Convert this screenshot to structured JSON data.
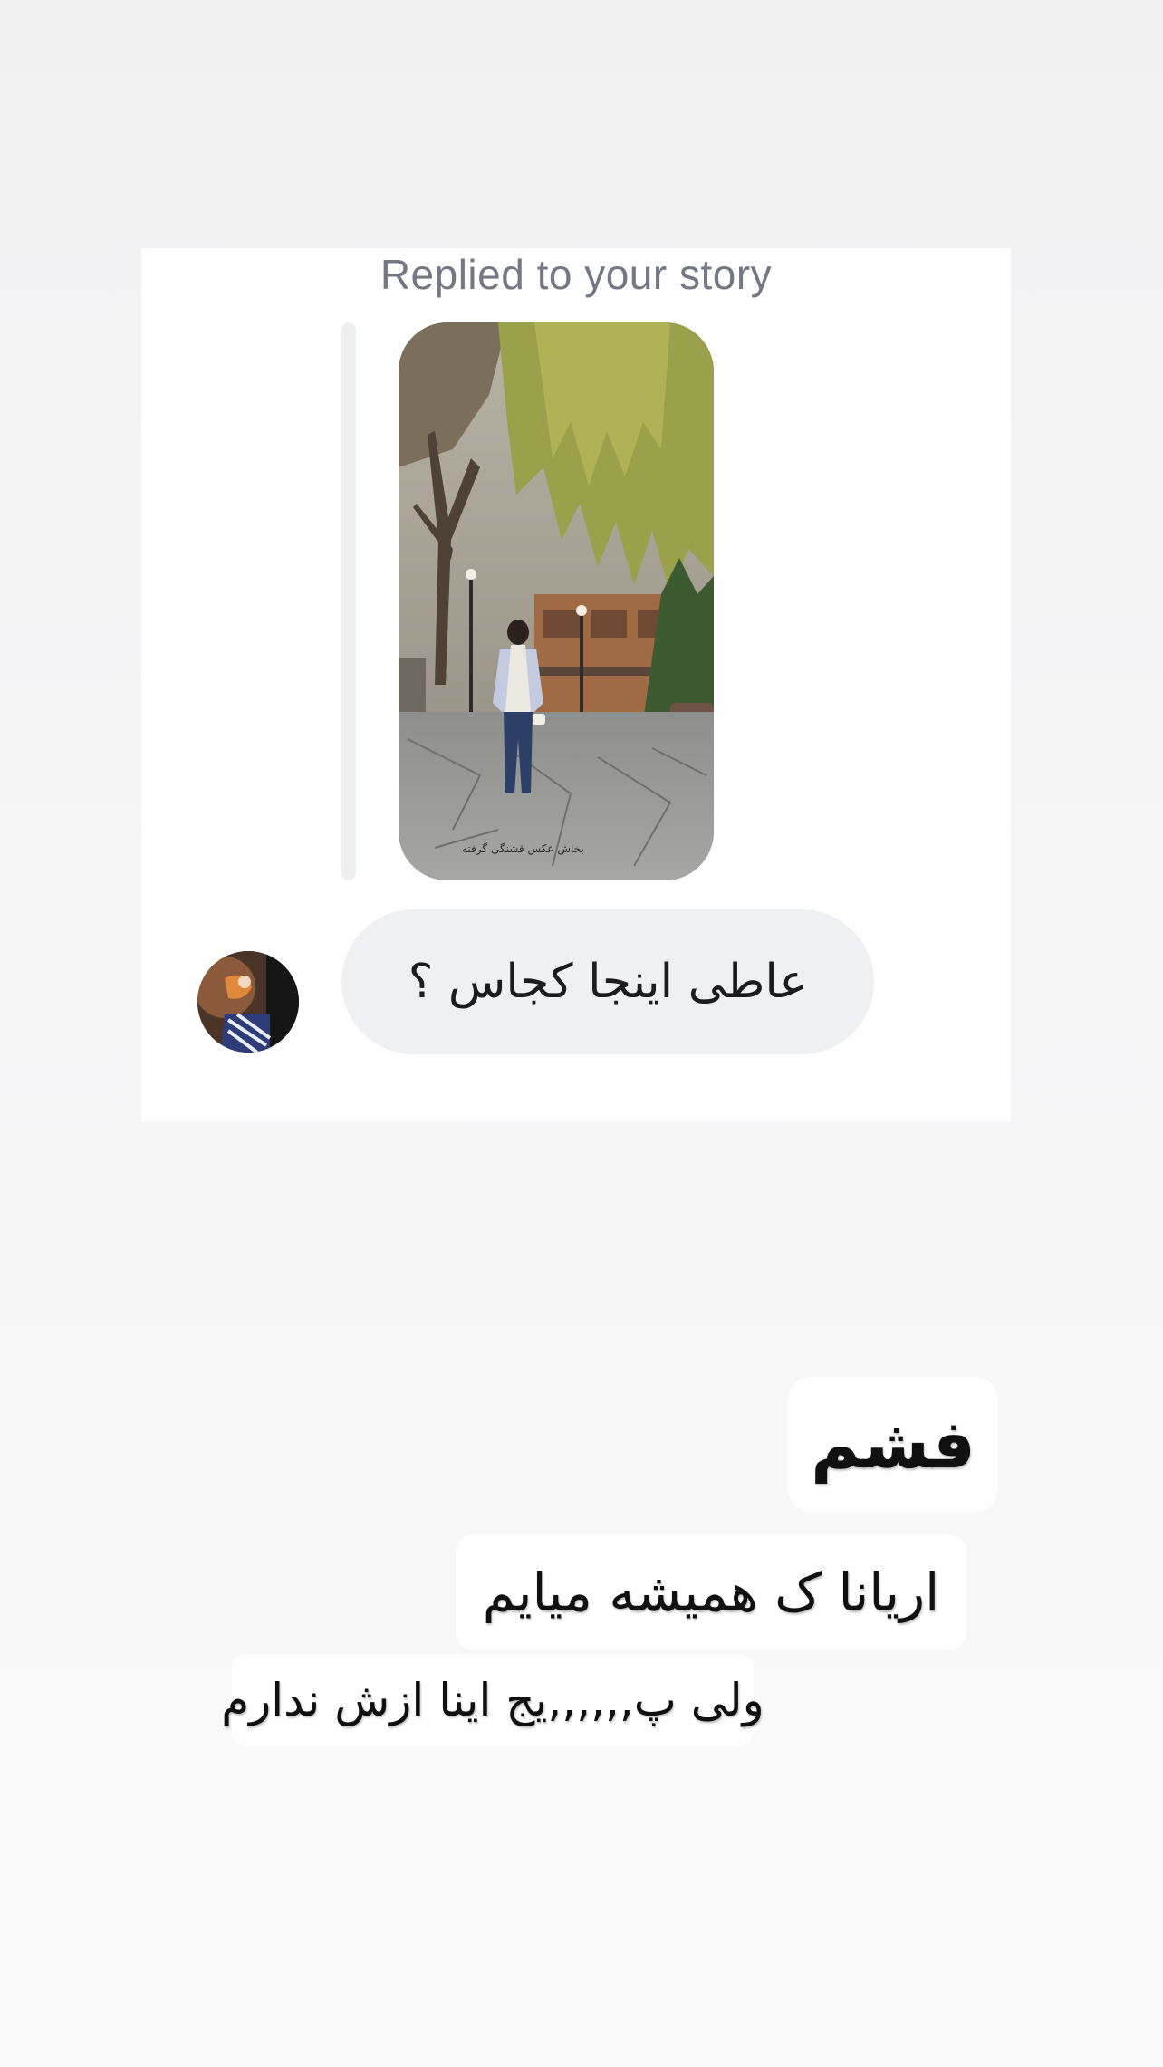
{
  "reply": {
    "label": "Replied to your story",
    "story_caption": "بخاش عکس قشنگی گرفته",
    "message": "عاطی اینجا کجاس ؟"
  },
  "captions": [
    "فشم",
    "اریانا ک همیشه میایم",
    "ولی پ,,,,,,یج اینا ازش ندارم"
  ]
}
